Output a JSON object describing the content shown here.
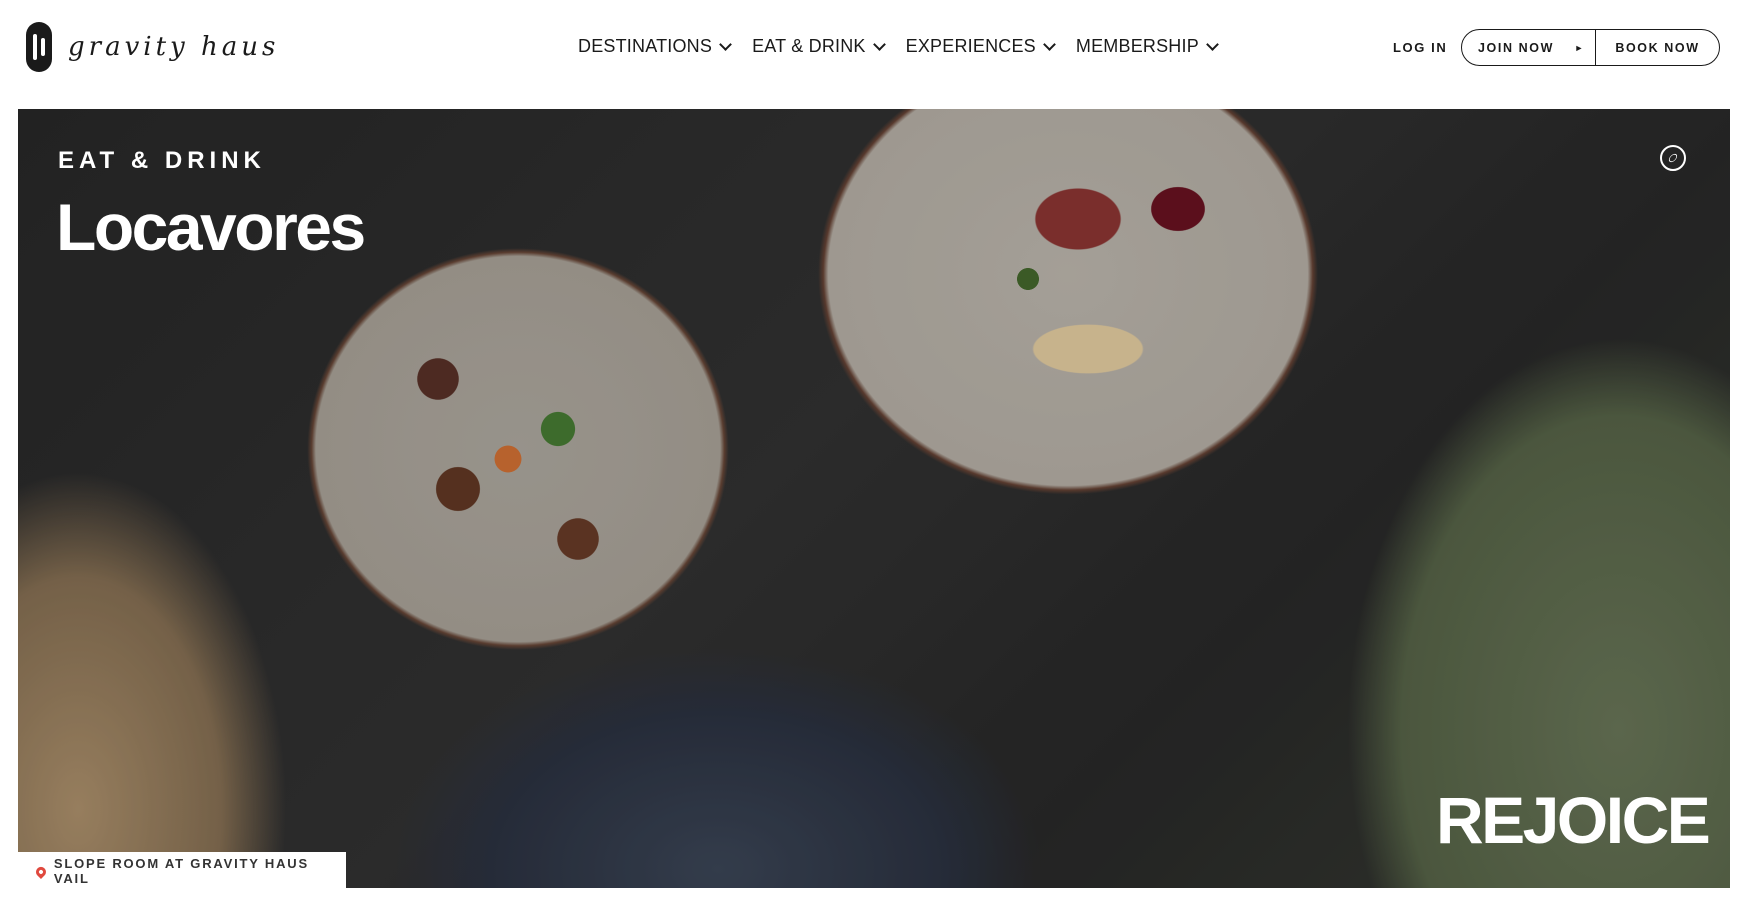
{
  "header": {
    "logo_text": "gravity haus",
    "nav": [
      {
        "label": "DESTINATIONS"
      },
      {
        "label": "EAT & DRINK"
      },
      {
        "label": "EXPERIENCES"
      },
      {
        "label": "MEMBERSHIP"
      }
    ],
    "login_label": "LOG IN",
    "join_label": "JOIN NOW",
    "book_label": "BOOK NOW"
  },
  "hero": {
    "subtitle": "EAT & DRINK",
    "title": "Locavores",
    "overlay_word": "REJOICE",
    "location_tag": "SLOPE ROOM AT GRAVITY HAUS VAIL",
    "icons": {
      "corner": "compass-icon",
      "location": "map-pin-icon"
    },
    "colors": {
      "overlay_text": "#ffffff",
      "pin": "#e0493e"
    }
  }
}
